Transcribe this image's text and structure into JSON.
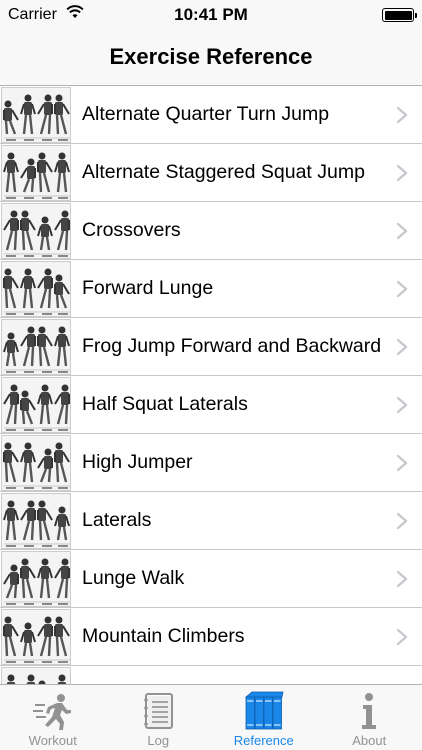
{
  "status_bar": {
    "carrier": "Carrier",
    "time": "10:41 PM",
    "icons": [
      "wifi-icon",
      "battery-icon"
    ]
  },
  "nav": {
    "title": "Exercise Reference"
  },
  "exercises": [
    {
      "label": "Alternate Quarter Turn Jump",
      "thumb": "exercise-illustration-icon"
    },
    {
      "label": "Alternate Staggered Squat Jump",
      "thumb": "exercise-illustration-icon"
    },
    {
      "label": "Crossovers",
      "thumb": "exercise-illustration-icon"
    },
    {
      "label": "Forward Lunge",
      "thumb": "exercise-illustration-icon"
    },
    {
      "label": "Frog Jump Forward and Backward",
      "thumb": "exercise-illustration-icon"
    },
    {
      "label": "Half Squat Laterals",
      "thumb": "exercise-illustration-icon"
    },
    {
      "label": "High Jumper",
      "thumb": "exercise-illustration-icon"
    },
    {
      "label": "Laterals",
      "thumb": "exercise-illustration-icon"
    },
    {
      "label": "Lunge Walk",
      "thumb": "exercise-illustration-icon"
    },
    {
      "label": "Mountain Climbers",
      "thumb": "exercise-illustration-icon"
    },
    {
      "label": "",
      "thumb": "exercise-illustration-icon"
    }
  ],
  "tabs": [
    {
      "label": "Workout",
      "icon": "runner-icon",
      "active": false
    },
    {
      "label": "Log",
      "icon": "notebook-icon",
      "active": false
    },
    {
      "label": "Reference",
      "icon": "books-icon",
      "active": true
    },
    {
      "label": "About",
      "icon": "info-icon",
      "active": false
    }
  ],
  "colors": {
    "accent": "#1a86e8",
    "inactive_tab": "#929292",
    "separator": "#c8c7cc",
    "bar_background": "#f8f8f8",
    "chevron": "#c7c7cc"
  }
}
